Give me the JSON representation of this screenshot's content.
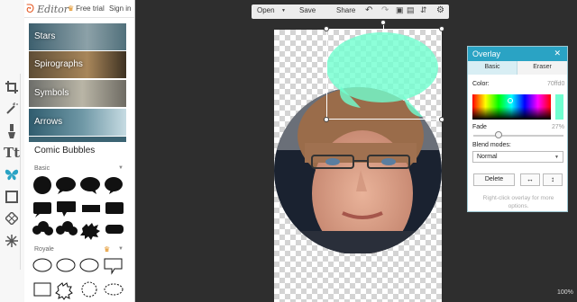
{
  "header": {
    "logo": "Editor",
    "free_trial": "Free trial",
    "sign_in": "Sign in"
  },
  "categories": [
    "Stars",
    "Spirographs",
    "Symbols",
    "Arrows"
  ],
  "panel": {
    "section_title": "Comic Bubbles",
    "sub_basic": "Basic",
    "sub_royale": "Royale"
  },
  "toolbar": {
    "open": "Open",
    "save": "Save",
    "share": "Share"
  },
  "status": {
    "zoom": "100%"
  },
  "overlay_dialog": {
    "title": "Overlay",
    "tabs": [
      "Basic",
      "Eraser"
    ],
    "color_label": "Color:",
    "color_value": "70ffd0",
    "fade_label": "Fade",
    "fade_value": "27%",
    "fade_fraction": 0.27,
    "blend_label": "Blend modes:",
    "blend_value": "Normal",
    "delete": "Delete",
    "hint": "Right-click overlay for more options."
  },
  "colors": {
    "accent": "#2aa3c4",
    "overlay": "#70ffd0",
    "brand": "#e55a25"
  }
}
